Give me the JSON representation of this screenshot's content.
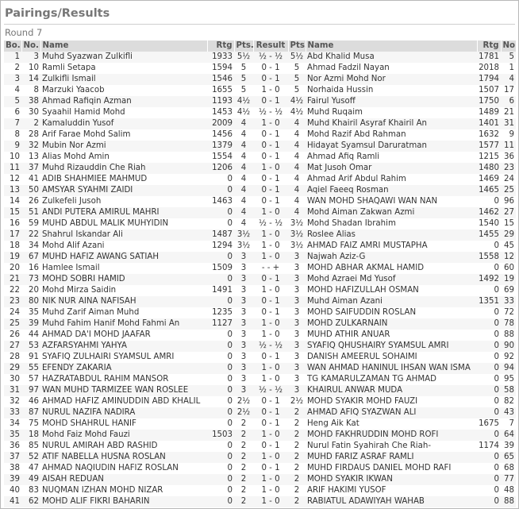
{
  "page": {
    "title": "Pairings/Results",
    "round": "Round 7"
  },
  "columns": [
    "Bo.",
    "No.",
    "Name",
    "Rtg",
    "Pts.",
    "Result",
    "Pts.",
    "Name",
    "Rtg",
    "No."
  ],
  "rows": [
    [
      "1",
      "3",
      "Muhd Syazwan Zulkifli",
      "1933",
      "5½",
      "½ - ½",
      "5½",
      "Abd Khalid Musa",
      "1781",
      "5"
    ],
    [
      "2",
      "10",
      "Ramli Setapa",
      "1594",
      "5",
      "0 - 1",
      "5",
      "Ahmad Fadzil Nayan",
      "2018",
      "1"
    ],
    [
      "3",
      "14",
      "Zulkifli Ismail",
      "1546",
      "5",
      "0 - 1",
      "5",
      "Nor Azmi Mohd Nor",
      "1794",
      "4"
    ],
    [
      "4",
      "8",
      "Marzuki Yaacob",
      "1655",
      "5",
      "1 - 0",
      "5",
      "Norhaida Hussin",
      "1507",
      "17"
    ],
    [
      "5",
      "38",
      "Ahmad Rafiqin Azman",
      "1193",
      "4½",
      "0 - 1",
      "4½",
      "Fairul Yusoff",
      "1750",
      "6"
    ],
    [
      "6",
      "30",
      "Syaahil Hamid Mohd",
      "1453",
      "4½",
      "½ - ½",
      "4½",
      "Muhd Ruqaim",
      "1489",
      "21"
    ],
    [
      "7",
      "2",
      "Kamaluddin Yusof",
      "2009",
      "4",
      "1 - 0",
      "4",
      "Muhd Khairil Asyraf Khairil An",
      "1401",
      "31"
    ],
    [
      "8",
      "28",
      "Arif Farae Mohd Salim",
      "1456",
      "4",
      "0 - 1",
      "4",
      "Mohd Razif Abd Rahman",
      "1632",
      "9"
    ],
    [
      "9",
      "32",
      "Mubin Nor Azmi",
      "1379",
      "4",
      "0 - 1",
      "4",
      "Hidayat Syamsul Daruratman",
      "1577",
      "11"
    ],
    [
      "10",
      "13",
      "Alias Mohd Amin",
      "1554",
      "4",
      "0 - 1",
      "4",
      "Ahmad Afiq Ramli",
      "1215",
      "36"
    ],
    [
      "11",
      "37",
      "Muhd Rizauddin Che Riah",
      "1206",
      "4",
      "1 - 0",
      "4",
      "Mat Jusoh Omar",
      "1480",
      "23"
    ],
    [
      "12",
      "41",
      "ADIB SHAHMIEE MAHMUD",
      "0",
      "4",
      "0 - 1",
      "4",
      "Ahmad Arif Abdul Rahim",
      "1469",
      "24"
    ],
    [
      "13",
      "50",
      "AMSYAR SYAHMI ZAIDI",
      "0",
      "4",
      "0 - 1",
      "4",
      "Aqiel Faeeq Rosman",
      "1465",
      "25"
    ],
    [
      "14",
      "26",
      "Zulkefeli Jusoh",
      "1463",
      "4",
      "0 - 1",
      "4",
      "WAN MOHD SHAQAWI WAN NAN",
      "0",
      "96"
    ],
    [
      "15",
      "51",
      "ANDI PUTERA AMIRUL MAHRI",
      "0",
      "4",
      "1 - 0",
      "4",
      "Mohd Aiman Zakwan Azmi",
      "1462",
      "27"
    ],
    [
      "16",
      "59",
      "MUHD ABDUL MALIK MUHYIDIN",
      "0",
      "4",
      "½ - ½",
      "3½",
      "Mohd Shadan Ibrahim",
      "1540",
      "15"
    ],
    [
      "17",
      "22",
      "Shahrul Iskandar Ali",
      "1487",
      "3½",
      "1 - 0",
      "3½",
      "Roslee Alias",
      "1455",
      "29"
    ],
    [
      "18",
      "34",
      "Mohd Alif Azani",
      "1294",
      "3½",
      "1 - 0",
      "3½",
      "AHMAD FAIZ AMRI MUSTAPHA",
      "0",
      "45"
    ],
    [
      "19",
      "67",
      "MUHD HAFIZ AWANG SATIAH",
      "0",
      "3",
      "1 - 0",
      "3",
      "Najwah Aziz-G",
      "1558",
      "12"
    ],
    [
      "20",
      "16",
      "Hamlee Ismail",
      "1509",
      "3",
      "- - +",
      "3",
      "MOHD ABHAR AKMAL HAMID",
      "0",
      "60"
    ],
    [
      "21",
      "73",
      "MOHD SOBRI HAMID",
      "0",
      "3",
      "0 - 1",
      "3",
      "Mohd Azraei Md Yusof",
      "1492",
      "19"
    ],
    [
      "22",
      "20",
      "Mohd Mirza Saidin",
      "1491",
      "3",
      "1 - 0",
      "3",
      "MOHD HAFIZULLAH OSMAN",
      "0",
      "69"
    ],
    [
      "23",
      "80",
      "NIK NUR AINA NAFISAH",
      "0",
      "3",
      "0 - 1",
      "3",
      "Muhd Aiman Azani",
      "1351",
      "33"
    ],
    [
      "24",
      "35",
      "Muhd Zarif Aiman Muhd",
      "1235",
      "3",
      "0 - 1",
      "3",
      "MOHD SAIFUDDIN ROSLAN",
      "0",
      "72"
    ],
    [
      "25",
      "39",
      "Muhd Fahim Hanif Mohd Fahmi An",
      "1127",
      "3",
      "1 - 0",
      "3",
      "MOHD ZULKARNAIN",
      "0",
      "78"
    ],
    [
      "26",
      "44",
      "AHMAD DA'I MOHD JAAFAR",
      "0",
      "3",
      "1 - 0",
      "3",
      "MUHD ATHIR ANUAR",
      "0",
      "88"
    ],
    [
      "27",
      "53",
      "AZFARSYAHMI YAHYA",
      "0",
      "3",
      "½ - ½",
      "3",
      "SYAFIQ QHUSHAIRY SYAMSUL AMRI",
      "0",
      "90"
    ],
    [
      "28",
      "91",
      "SYAFIQ ZULHAIRI SYAMSUL AMRI",
      "0",
      "3",
      "0 - 1",
      "3",
      "DANISH AMEERUL SOHAIMI",
      "0",
      "92"
    ],
    [
      "29",
      "55",
      "EFENDY ZAKARIA",
      "0",
      "3",
      "1 - 0",
      "3",
      "WAN AHMAD HANINUL IHSAN WAN ISMA",
      "0",
      "94"
    ],
    [
      "30",
      "57",
      "HAZRATABDUL RAHIM MANSOR",
      "0",
      "3",
      "1 - 0",
      "3",
      "TG KAMARULZAMAN TG AHMAD",
      "0",
      "95"
    ],
    [
      "31",
      "97",
      "WAN MUHD TARMIZEE WAN ROSLEE",
      "0",
      "3",
      "½ - ½",
      "3",
      "KHAIRUL ANWAR MUDA",
      "0",
      "58"
    ],
    [
      "32",
      "46",
      "AHMAD HAFIZ AMINUDDIN ABD KHALIL",
      "0",
      "2½",
      "0 - 1",
      "2½",
      "MOHD SYAKIR MOHD FAUZI",
      "0",
      "82"
    ],
    [
      "33",
      "87",
      "NURUL NAZIFA NADIRA",
      "0",
      "2½",
      "0 - 1",
      "2",
      "AHMAD AFIQ SYAZWAN ALI",
      "0",
      "43"
    ],
    [
      "34",
      "75",
      "MOHD SHAHRUL HANIF",
      "0",
      "2",
      "0 - 1",
      "2",
      "Heng Aik Kat",
      "1675",
      "7"
    ],
    [
      "35",
      "18",
      "Mohd Faiz Mohd Fauzi",
      "1503",
      "2",
      "1 - 0",
      "2",
      "MOHD FAKHRUDDIN MOHD ROFI",
      "0",
      "64"
    ],
    [
      "36",
      "85",
      "NURUL AMIRAH ABD RASHID",
      "0",
      "2",
      "0 - 1",
      "2",
      "Nurul Fatin Syahirah Che Riah-",
      "1174",
      "39"
    ],
    [
      "37",
      "52",
      "ATIF NABELLA HUSNA ROSLAN",
      "0",
      "2",
      "1 - 0",
      "2",
      "MUHD FARIZ ASRAF RAMLI",
      "0",
      "65"
    ],
    [
      "38",
      "47",
      "AHMAD NAQIUDIN HAFIZ ROSLAN",
      "0",
      "2",
      "0 - 1",
      "2",
      "MUHD FIRDAUS DANIEL MOHD RAFI",
      "0",
      "68"
    ],
    [
      "39",
      "49",
      "AISAH REDUAN",
      "0",
      "2",
      "1 - 0",
      "2",
      "MOHD SYAKIR IKWAN",
      "0",
      "77"
    ],
    [
      "40",
      "83",
      "NUQMAN IZHAN MOHD NIZAR",
      "0",
      "2",
      "1 - 0",
      "2",
      "ARIF HAKIMI YUSOF",
      "0",
      "48"
    ],
    [
      "41",
      "62",
      "MOHD ALIF FIKRI BAHARIN",
      "0",
      "2",
      "1 - 0",
      "2",
      "RABIATUL ADAWIYAH WAHAB",
      "0",
      "88"
    ]
  ]
}
